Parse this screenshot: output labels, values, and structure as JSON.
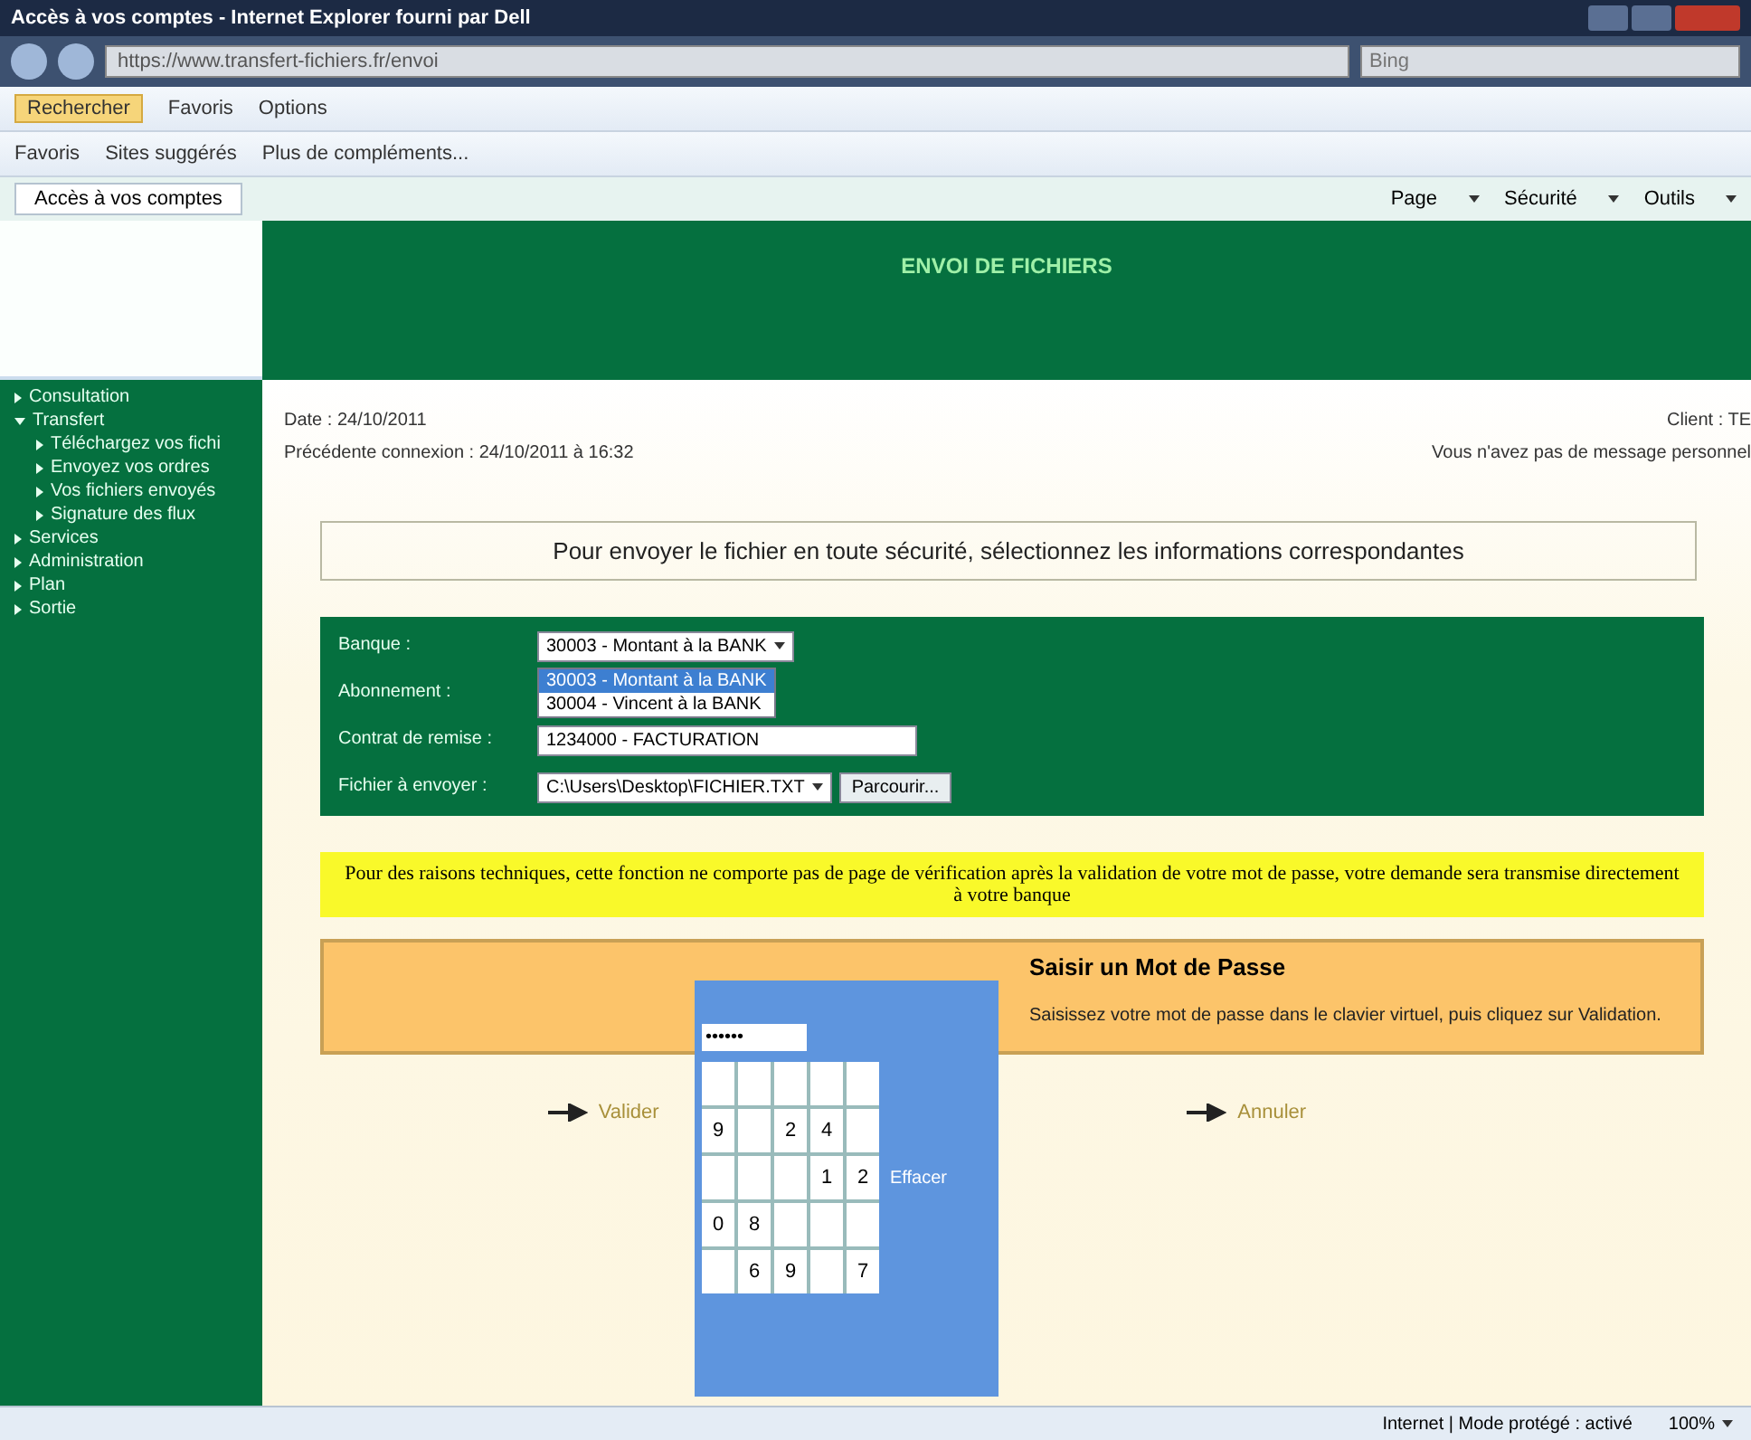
{
  "window": {
    "title": "Accès à vos comptes - Internet Explorer fourni par Dell"
  },
  "browser": {
    "address": "https://www.transfert-fichiers.fr/envoi",
    "search_placeholder": "Bing",
    "toolbar": [
      "Rechercher",
      "Favoris",
      "Options"
    ],
    "favorites": [
      "Favoris",
      "Sites suggérés",
      "Plus de compléments..."
    ],
    "tab": "Accès à vos comptes",
    "commands": [
      "Page",
      "Sécurité",
      "Outils"
    ]
  },
  "header": {
    "title": "ENVOI DE FICHIERS"
  },
  "sidebar": {
    "items": [
      {
        "label": "Consultation",
        "expanded": false
      },
      {
        "label": "Transfert",
        "expanded": true,
        "children": [
          {
            "label": "Téléchargez vos fichi"
          },
          {
            "label": "Envoyez vos ordres"
          },
          {
            "label": "Vos fichiers envoyés"
          },
          {
            "label": "Signature des flux"
          }
        ]
      },
      {
        "label": "Services",
        "expanded": false
      },
      {
        "label": "Administration",
        "expanded": false
      },
      {
        "label": "Plan",
        "expanded": false
      },
      {
        "label": "Sortie",
        "expanded": false
      }
    ]
  },
  "info": {
    "date": "Date : 24/10/2011",
    "last_login": "Précédente connexion : 24/10/2011 à 16:32",
    "client": "Client : TE",
    "messages": "Vous n'avez pas de message personnel"
  },
  "instruction": "Pour envoyer le fichier en toute sécurité, sélectionnez les informations correspondantes",
  "form": {
    "fields": [
      {
        "kind": "select",
        "label": "Banque :",
        "value": "30003 - Montant à la BANK",
        "options": [
          {
            "label": "30003 - Montant à la BANK",
            "selected": true
          },
          {
            "label": "30004 - Vincent à la BANK",
            "selected": false
          }
        ]
      },
      {
        "kind": "blank",
        "label": "Abonnement :"
      },
      {
        "kind": "input",
        "label": "Contrat de remise :",
        "value": "1234000 - FACTURATION"
      },
      {
        "kind": "file",
        "label": "Fichier à envoyer :",
        "value": "C:\\Users\\Desktop\\FICHIER.TXT",
        "button": "Parcourir..."
      }
    ]
  },
  "notice": "Pour des raisons techniques, cette fonction ne comporte pas de page de vérification après la validation de votre mot de passe, votre demande sera transmise directement à votre banque",
  "password_panel": {
    "title": "Saisir un Mot de Passe",
    "hint": "Saisissez votre mot de passe dans le clavier virtuel, puis cliquez sur Validation."
  },
  "keypad": {
    "field": "••••••",
    "keys": [
      {
        "kind": "blank"
      },
      {
        "kind": "blank"
      },
      {
        "kind": "blank"
      },
      {
        "kind": "blank"
      },
      {
        "kind": "blank"
      },
      {
        "kind": "digit",
        "label": "9"
      },
      {
        "kind": "blank"
      },
      {
        "kind": "digit",
        "label": "2"
      },
      {
        "kind": "digit",
        "label": "4"
      },
      {
        "kind": "blank"
      },
      {
        "kind": "blank"
      },
      {
        "kind": "blank"
      },
      {
        "kind": "blank"
      },
      {
        "kind": "digit",
        "label": "1"
      },
      {
        "kind": "digit",
        "label": "2"
      },
      {
        "kind": "digit",
        "label": "0"
      },
      {
        "kind": "digit",
        "label": "8"
      },
      {
        "kind": "blank"
      },
      {
        "kind": "blank"
      },
      {
        "kind": "blank"
      },
      {
        "kind": "blank"
      },
      {
        "kind": "digit",
        "label": "6"
      },
      {
        "kind": "digit",
        "label": "9"
      },
      {
        "kind": "blank"
      },
      {
        "kind": "digit",
        "label": "7"
      }
    ],
    "action": "Effacer"
  },
  "actions": [
    "Valider",
    "Annuler"
  ],
  "status_bar": {
    "zone": "Internet | Mode protégé : activé",
    "zoom": "100%"
  }
}
